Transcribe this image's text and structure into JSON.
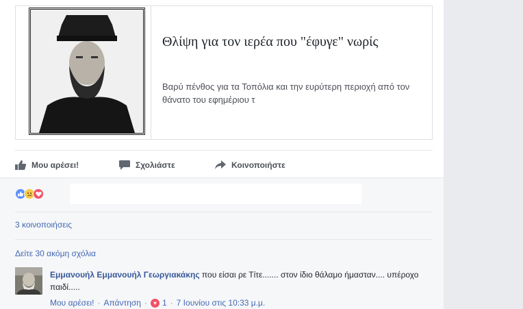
{
  "link_preview": {
    "title": "Θλίψη για τον ιερέα που \"έφυγε\" νωρίς",
    "description": "Βαρύ πένθος για τα Τοπόλια και την ευρύτερη περιοχή από τον θάνατο του εφημέριου τ"
  },
  "actions": {
    "like_label": "Μου αρέσει!",
    "comment_label": "Σχολιάστε",
    "share_label": "Κοινοποιήστε"
  },
  "reactions": {
    "icons": [
      "like-icon",
      "sad-icon",
      "love-icon"
    ]
  },
  "shares_text": "3 κοινοποιήσεις",
  "more_comments_text": "Δείτε 30 ακόμη σχόλια",
  "comment": {
    "author": "Εμμανουήλ Εμμανουήλ Γεωργιακάκης",
    "text": " που είσαι ρε Τίτε....... στον ίδιο θάλαμο ήμασταν.... υπέροχο παιδί.....",
    "like_label": "Μου αρέσει!",
    "reply_label": "Απάντηση",
    "reaction_count": "1",
    "timestamp": "7 Ιουνίου στις 10:33 μ.μ."
  },
  "colors": {
    "link_blue": "#4267b2",
    "author_blue": "#365899",
    "like_blue": "#5890ff",
    "love_red": "#f25268",
    "sad_yellow": "#f7c947"
  }
}
